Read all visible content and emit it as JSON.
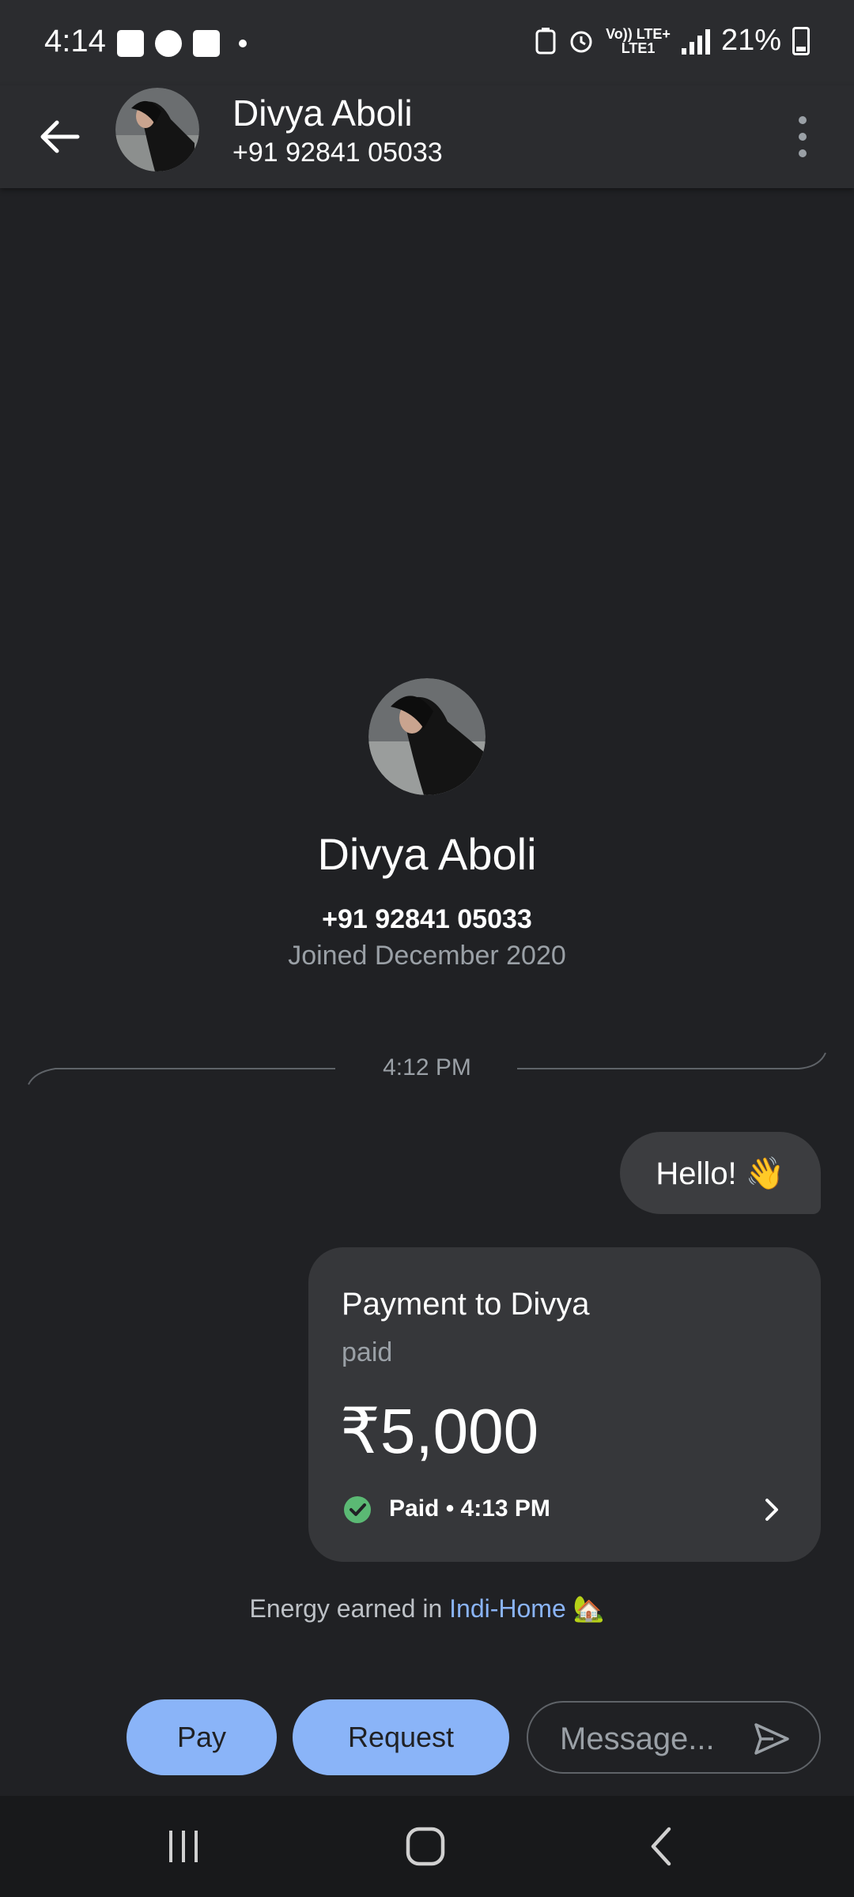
{
  "status_bar": {
    "time": "4:14",
    "network_top": "Vo)) LTE+",
    "network_bottom": "LTE1",
    "battery": "21%"
  },
  "header": {
    "name": "Divya Aboli",
    "phone": "+91 92841 05033"
  },
  "profile": {
    "name": "Divya Aboli",
    "phone": "+91 92841 05033",
    "joined": "Joined December 2020"
  },
  "chat": {
    "timestamp": "4:12 PM",
    "message": "Hello! 👋",
    "payment": {
      "title": "Payment to Divya",
      "subtitle": "paid",
      "amount": "₹5,000",
      "status": "Paid • 4:13 PM"
    },
    "energy_prefix": "Energy earned in ",
    "energy_link": "Indi-Home",
    "energy_emoji": "🏡"
  },
  "actions": {
    "pay": "Pay",
    "request": "Request",
    "message_placeholder": "Message..."
  },
  "colors": {
    "accent": "#8ab4f8",
    "success": "#5bb974",
    "background": "#202124"
  }
}
